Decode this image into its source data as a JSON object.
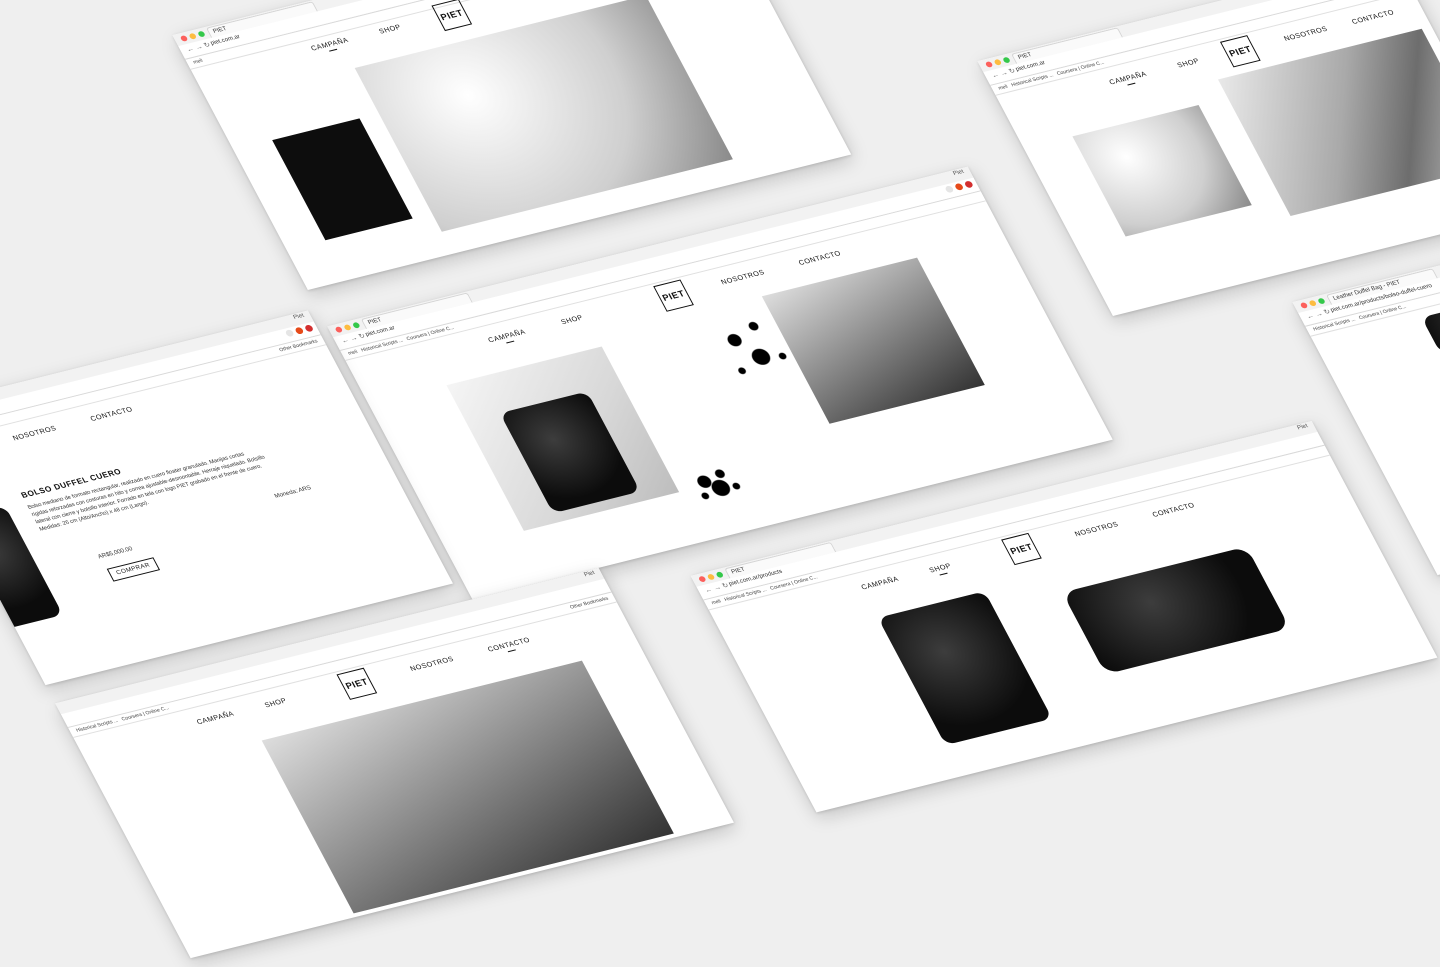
{
  "brand": {
    "logo_text": "PIET"
  },
  "browser": {
    "user_label": "Piet",
    "tab_title_main": "PIET",
    "tab_title_product": "Leather Duffel Bag - PIET",
    "url_home": "piet.com.ar",
    "url_products": "piet.com.ar/products",
    "url_product": "piet.com.ar/products/bolso-duffel-cuero",
    "bookmarks": [
      "meli",
      "Historical Scripts ...",
      "Coursera | Online C..."
    ],
    "other_bookmarks": "Other Bookmarks"
  },
  "nav": {
    "campana": "Campaña",
    "shop": "Shop",
    "nosotros": "Nosotros",
    "contacto": "Contacto"
  },
  "product": {
    "title": "BOLSO DUFFEL CUERO",
    "description": "Bolso mediano de formato rectangular, realizado en cuero floater granulado. Manijas cortas rígidas reforzadas con costuras en hilo y correa ajustable-desmontable. Herraje niquelado. Bolsillo lateral con cierre y bolsillo interior. Forrado en tela con logo PIET grabado en el frente de cuero. Medidas: 26 cm (Alto/Ancho) x 48 cm (Largo).",
    "price": "AR$5,000.00",
    "buy_label": "COMPRAR",
    "currency_label": "Moneda: ARS"
  },
  "colors": {
    "background": "#efefef",
    "window": "#ffffff",
    "traffic_red": "#fc605c",
    "traffic_yellow": "#fdbc40",
    "traffic_green": "#34c84a",
    "ink": "#111111"
  }
}
